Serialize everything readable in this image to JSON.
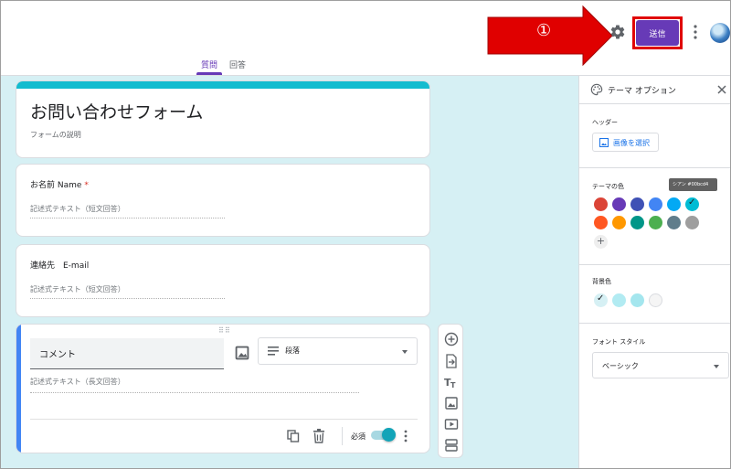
{
  "header": {
    "tabs": [
      {
        "label": "質問",
        "active": true
      },
      {
        "label": "回答",
        "active": false
      }
    ],
    "callout_number": "①",
    "send_label": "送信",
    "icons": [
      "settings-gear-icon",
      "more-vert-icon",
      "avatar"
    ]
  },
  "form": {
    "title": "お問い合わせフォーム",
    "description": "フォームの説明",
    "questions": [
      {
        "label": "お名前 Name",
        "required": true,
        "answer_placeholder": "記述式テキスト（短文回答）"
      },
      {
        "label": "連絡先　E-mail",
        "required": false,
        "answer_placeholder": "記述式テキスト（短文回答）"
      }
    ],
    "active_question": {
      "title": "コメント",
      "type_label": "段落",
      "answer_placeholder": "記述式テキスト（長文回答）",
      "required_label": "必須",
      "required_on": true
    }
  },
  "theme_panel": {
    "title": "テーマ オプション",
    "header_label": "ヘッダー",
    "select_image_label": "画像を選択",
    "theme_color_label": "テーマの色",
    "tooltip": "シアン #00bcd4",
    "theme_colors": [
      "#db4437",
      "#673ab7",
      "#3f51b5",
      "#4285f4",
      "#03a9f4",
      "#00bcd4",
      "#ff5722",
      "#ff9800",
      "#009688",
      "#4caf50",
      "#607d8b",
      "#9e9e9e"
    ],
    "selected_theme_color": "#00bcd4",
    "bg_color_label": "背景色",
    "bg_colors": [
      "#d6f0f4",
      "#b2ebf2",
      "#a4e6ee",
      "#f5f5f5"
    ],
    "selected_bg_color": "#d6f0f4",
    "font_style_label": "フォント スタイル",
    "font_style_value": "ベーシック"
  },
  "colors": {
    "accent": "#673ab7",
    "highlight_outline": "#e00000",
    "arrow": "#e00000",
    "canvas_bg": "#d6f0f4"
  }
}
